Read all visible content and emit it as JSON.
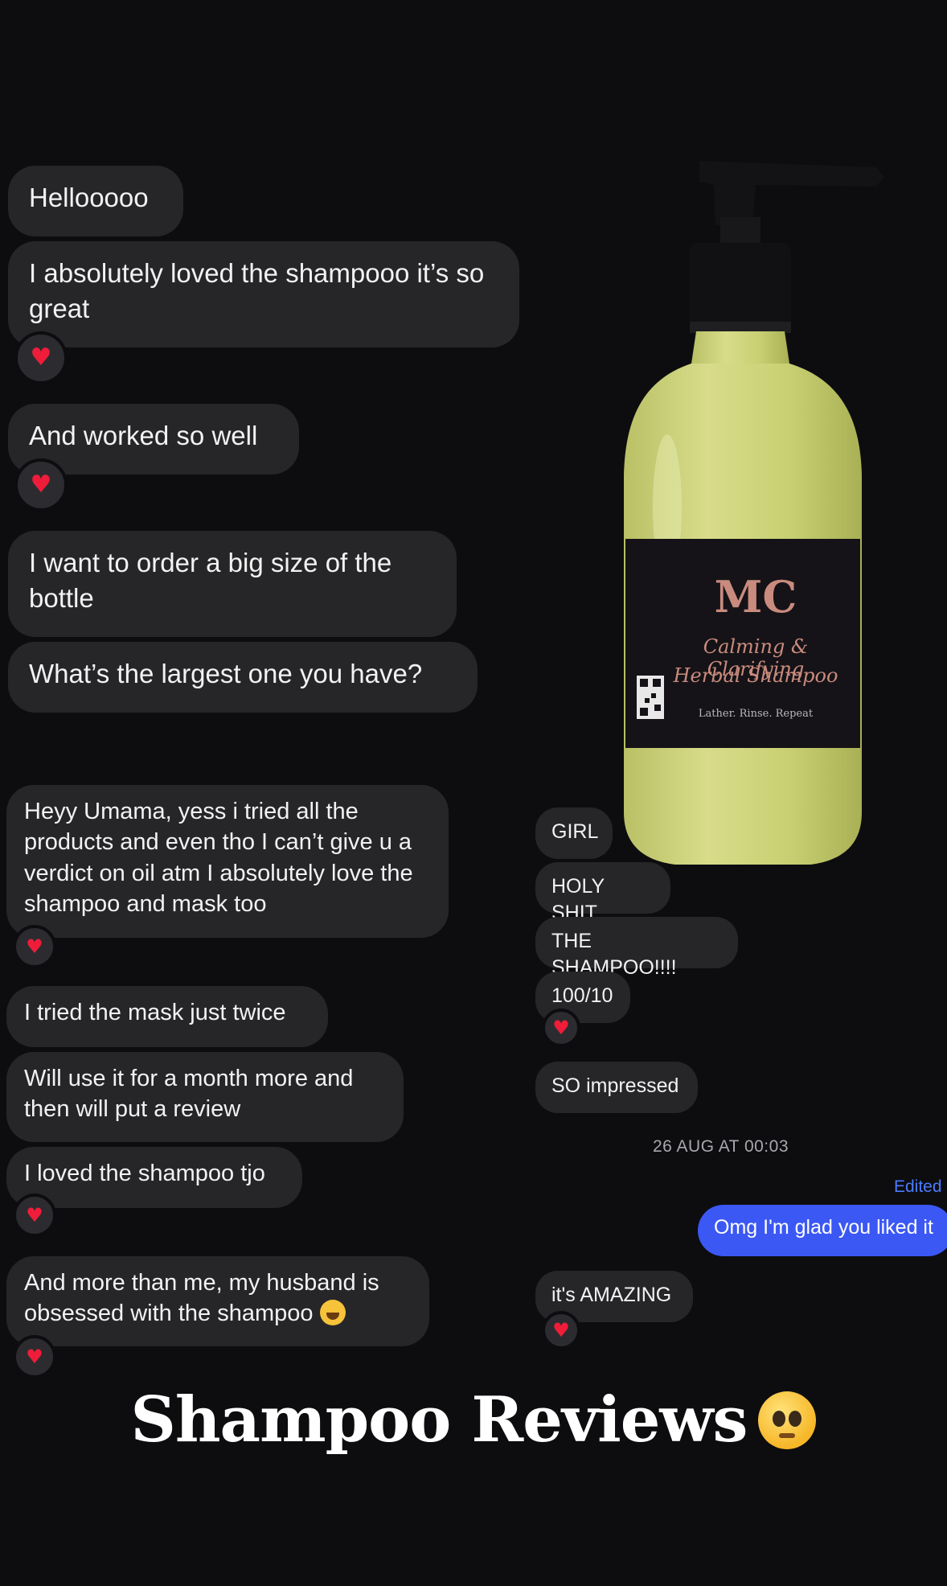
{
  "left_messages": [
    {
      "text": "Hellooooo"
    },
    {
      "text": "I absolutely loved the shampooo it’s so great"
    },
    {
      "text": "And worked so well"
    },
    {
      "text": "I want to order a big size of the bottle"
    },
    {
      "text": "What’s the largest one you have?"
    },
    {
      "text": "Heyy Umama, yess i tried all the products and even tho I can’t give u a verdict on oil atm I absolutely love the shampoo and mask too"
    },
    {
      "text": "I tried the mask just twice"
    },
    {
      "text": "Will use it for a month more and then will put a review"
    },
    {
      "text": "I loved the shampoo tjo"
    },
    {
      "text": "And more than me, my husband is obsessed with the shampoo"
    }
  ],
  "right_messages": [
    {
      "text": "GIRL"
    },
    {
      "text": "HOLY SHIT"
    },
    {
      "text": "THE SHAMPOO!!!!"
    },
    {
      "text": "100/10"
    },
    {
      "text": "SO impressed"
    },
    {
      "text": "it's AMAZING"
    }
  ],
  "timestamp": "26 AUG AT 00:03",
  "edited_label": "Edited",
  "sent_message": "Omg I'm glad you liked it",
  "reaction_icon": "heart-icon",
  "product": {
    "brand": "MC",
    "name_line1": "Calming & Clarifying",
    "name_line2": "Herbal Shampoo",
    "tagline": "Lather. Rinse. Repeat",
    "liquid_color": "#cbd27a",
    "label_color": "#151317"
  },
  "title": "Shampoo Reviews",
  "colors": {
    "background": "#0d0d10",
    "bubble": "#262629",
    "sent_bubble": "#3b58f5",
    "heart": "#ef1d3a",
    "edited": "#4b7bff"
  }
}
